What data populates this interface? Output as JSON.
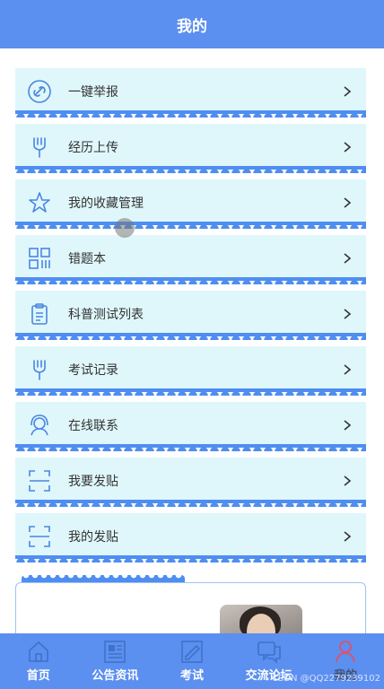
{
  "header": {
    "title": "我的"
  },
  "menu": {
    "items": [
      {
        "label": "一键举报",
        "icon": "link-icon"
      },
      {
        "label": "经历上传",
        "icon": "tool-icon"
      },
      {
        "label": "我的收藏管理",
        "icon": "star-icon"
      },
      {
        "label": "错题本",
        "icon": "grid-icon"
      },
      {
        "label": "科普测试列表",
        "icon": "clipboard-icon"
      },
      {
        "label": "考试记录",
        "icon": "tool-icon"
      },
      {
        "label": "在线联系",
        "icon": "user-headset-icon"
      },
      {
        "label": "我要发贴",
        "icon": "scan-icon"
      },
      {
        "label": "我的发贴",
        "icon": "scan-icon"
      }
    ]
  },
  "tabbar": {
    "items": [
      {
        "label": "首页",
        "icon": "home-icon"
      },
      {
        "label": "公告资讯",
        "icon": "news-icon"
      },
      {
        "label": "考试",
        "icon": "exam-icon"
      },
      {
        "label": "交流论坛",
        "icon": "forum-icon"
      },
      {
        "label": "我的",
        "icon": "profile-icon"
      }
    ],
    "active_index": 4
  },
  "watermark": "CSDN @QQ2279239102",
  "colors": {
    "primary": "#5b8ff0",
    "item_bg": "#dff7fb",
    "wave": "#4f8ef0",
    "icon": "#4a86e0"
  }
}
